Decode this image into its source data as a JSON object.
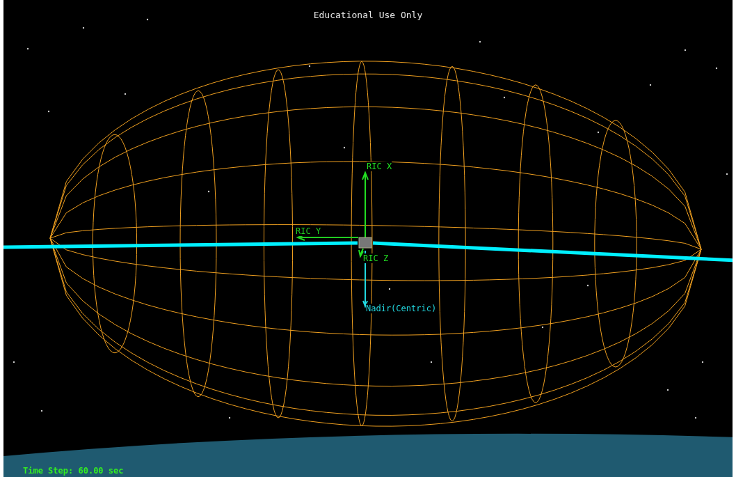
{
  "overlay_title": "Educational Use Only",
  "axes": [
    {
      "label": "RIC X",
      "kind": "x"
    },
    {
      "label": "RIC Y",
      "kind": "y"
    },
    {
      "label": "RIC Z",
      "kind": "z"
    },
    {
      "label": "Nadir(Centric)",
      "kind": "nadir"
    }
  ],
  "status": "Time Step: 60.00 sec"
}
